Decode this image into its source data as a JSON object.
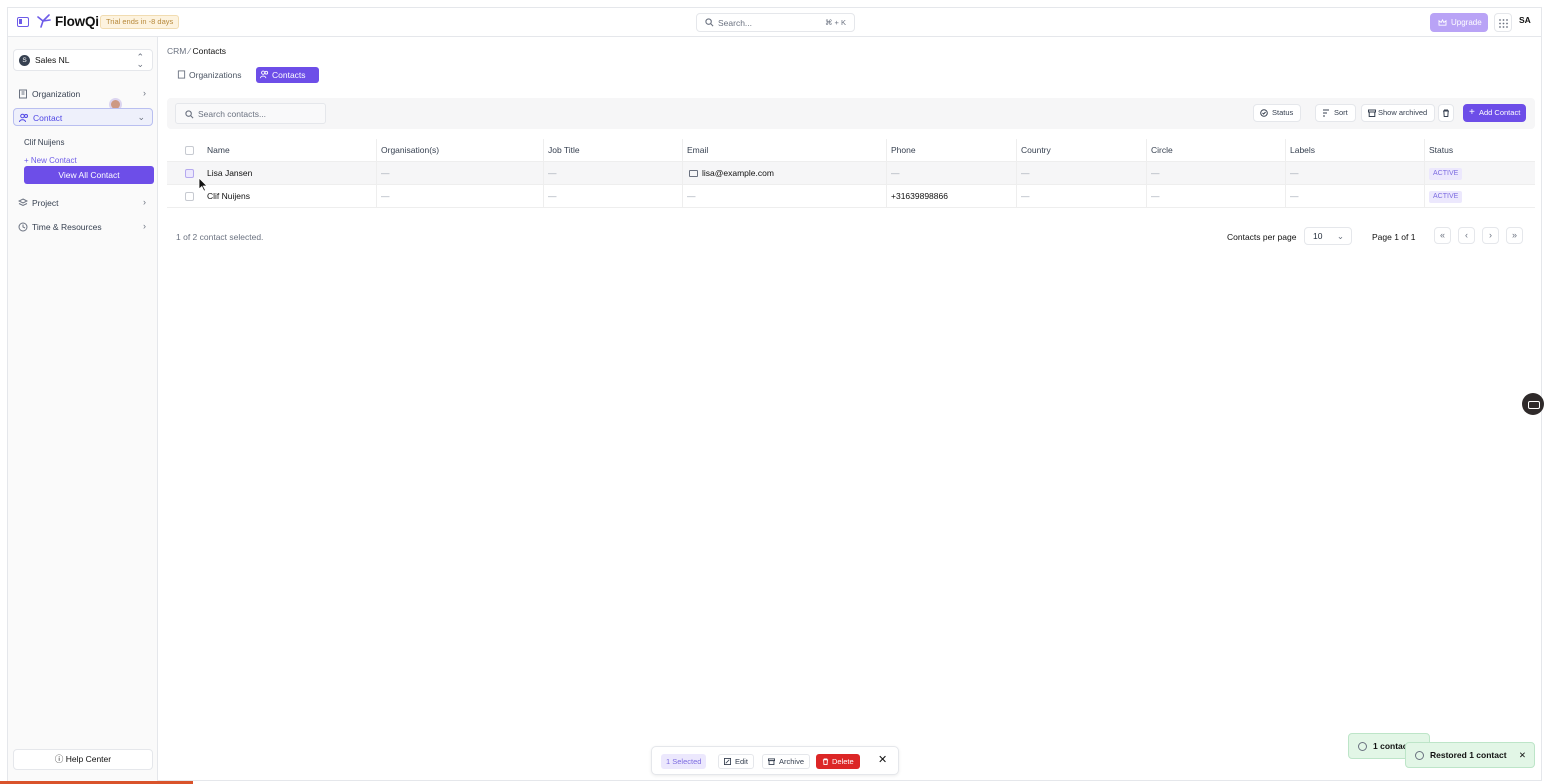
{
  "app": {
    "name": "FlowQi",
    "trial_badge": "Trial ends in -8 days"
  },
  "search": {
    "placeholder": "Search...",
    "shortcut": "⌘ + K"
  },
  "header": {
    "upgrade_label": "Upgrade",
    "user_initials": "SA"
  },
  "sidebar": {
    "workspace": {
      "initial": "S",
      "name": "Sales NL"
    },
    "items": [
      {
        "label": "Organization"
      },
      {
        "label": "Contact"
      },
      {
        "label": "Project"
      },
      {
        "label": "Time & Resources"
      }
    ],
    "contact_sub": {
      "recent": "Clif Nuijens",
      "new": "New Contact",
      "view_all": "View All Contact"
    },
    "help": "Help Center"
  },
  "breadcrumb": {
    "root": "CRM",
    "current": "Contacts"
  },
  "tabs": [
    {
      "label": "Organizations"
    },
    {
      "label": "Contacts"
    }
  ],
  "toolbar": {
    "search_placeholder": "Search contacts...",
    "status": "Status",
    "sort": "Sort",
    "show_archived": "Show archived",
    "add_contact": "Add Contact"
  },
  "table": {
    "columns": [
      "Name",
      "Organisation(s)",
      "Job Title",
      "Email",
      "Phone",
      "Country",
      "Circle",
      "Labels",
      "Status"
    ],
    "rows": [
      {
        "name": "Lisa Jansen",
        "org": "—",
        "job": "—",
        "email": "lisa@example.com",
        "phone": "—",
        "country": "—",
        "circle": "—",
        "labels": "—",
        "status": "ACTIVE"
      },
      {
        "name": "Clif Nuijens",
        "org": "—",
        "job": "—",
        "email": "—",
        "phone": "+31639898866",
        "country": "—",
        "circle": "—",
        "labels": "—",
        "status": "ACTIVE"
      }
    ]
  },
  "footer": {
    "selected_text": "1 of 2 contact selected.",
    "per_page_label": "Contacts per page",
    "per_page_value": "10",
    "page_label": "Page 1 of 1",
    "first": "«",
    "prev": "‹",
    "next": "›",
    "last": "»"
  },
  "bulk_bar": {
    "selected": "1 Selected",
    "edit": "Edit",
    "archive": "Archive",
    "delete": "Delete",
    "close": "✕"
  },
  "toasts": {
    "back": "1 contac",
    "front": "Restored 1 contact",
    "close": "✕"
  }
}
